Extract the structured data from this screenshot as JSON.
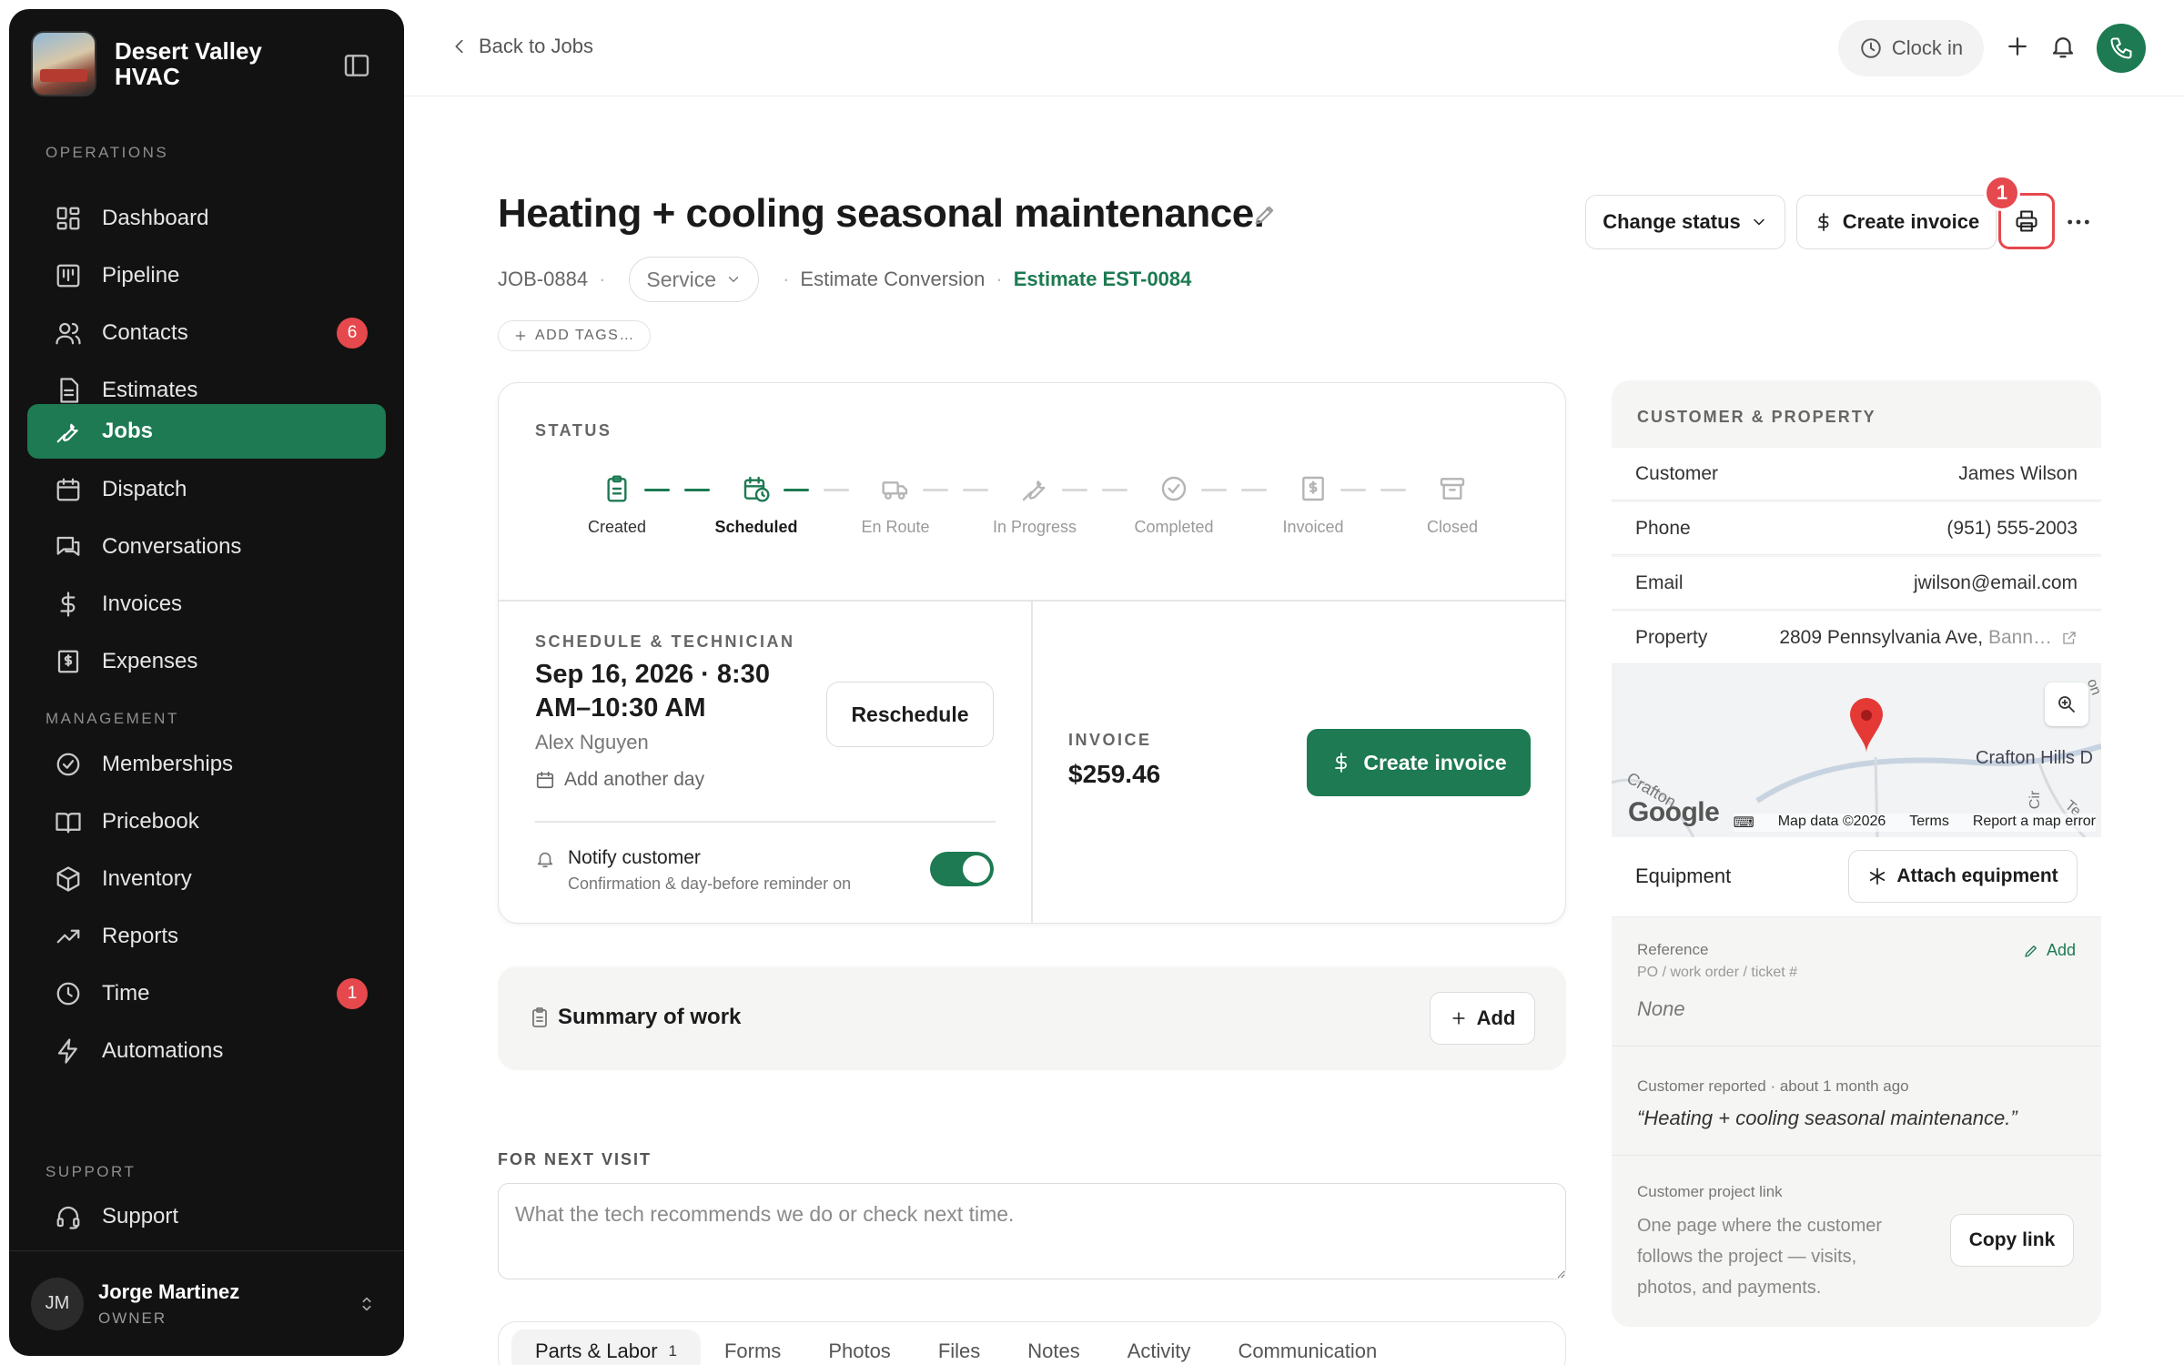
{
  "brand": {
    "name": "Desert Valley HVAC"
  },
  "sidebar": {
    "sections": {
      "operations": "OPERATIONS",
      "management": "MANAGEMENT",
      "support": "SUPPORT"
    },
    "items": [
      {
        "label": "Dashboard",
        "icon": "dashboard-icon"
      },
      {
        "label": "Pipeline",
        "icon": "pipeline-icon"
      },
      {
        "label": "Contacts",
        "icon": "contacts-icon",
        "badge": "6"
      },
      {
        "label": "Estimates",
        "icon": "estimates-icon"
      },
      {
        "label": "Jobs",
        "icon": "wrench-icon",
        "active": true
      },
      {
        "label": "Dispatch",
        "icon": "calendar-icon"
      },
      {
        "label": "Conversations",
        "icon": "chat-icon"
      },
      {
        "label": "Invoices",
        "icon": "dollar-icon"
      },
      {
        "label": "Expenses",
        "icon": "receipt-icon"
      },
      {
        "label": "Memberships",
        "icon": "badge-check-icon"
      },
      {
        "label": "Pricebook",
        "icon": "book-icon"
      },
      {
        "label": "Inventory",
        "icon": "box-icon"
      },
      {
        "label": "Reports",
        "icon": "trend-icon"
      },
      {
        "label": "Time",
        "icon": "clock-icon",
        "badge": "1"
      },
      {
        "label": "Automations",
        "icon": "bolt-icon"
      },
      {
        "label": "Support",
        "icon": "headset-icon"
      }
    ],
    "user": {
      "initials": "JM",
      "name": "Jorge Martinez",
      "role": "OWNER"
    }
  },
  "topbar": {
    "back_label": "Back to Jobs",
    "clock_label": "Clock in"
  },
  "job": {
    "title": "Heating + cooling seasonal maintenance.",
    "id": "JOB-0884",
    "type": "Service",
    "source": "Estimate Conversion",
    "estimate_link": "Estimate EST-0084",
    "add_tags": "ADD TAGS…",
    "actions": {
      "change_status": "Change status",
      "create_invoice": "Create invoice",
      "print_badge": "1"
    }
  },
  "status": {
    "label": "STATUS",
    "steps": [
      {
        "label": "Created",
        "state": "done"
      },
      {
        "label": "Scheduled",
        "state": "current"
      },
      {
        "label": "En Route",
        "state": "pending"
      },
      {
        "label": "In Progress",
        "state": "pending"
      },
      {
        "label": "Completed",
        "state": "pending"
      },
      {
        "label": "Invoiced",
        "state": "pending"
      },
      {
        "label": "Closed",
        "state": "pending"
      }
    ],
    "colors": {
      "accent": "#1d7a52",
      "pending": "#b5b5b5"
    }
  },
  "schedule": {
    "label": "SCHEDULE & TECHNICIAN",
    "date": "Sep 16, 2026 · 8:30 AM–10:30 AM",
    "technician": "Alex Nguyen",
    "add_day": "Add another day",
    "reschedule": "Reschedule",
    "notify_title": "Notify customer",
    "notify_sub": "Confirmation & day-before reminder on",
    "notify_on": true
  },
  "invoice": {
    "label": "INVOICE",
    "amount": "$259.46",
    "button": "Create invoice"
  },
  "summary": {
    "title": "Summary of work",
    "add": "Add"
  },
  "next_visit": {
    "label": "FOR NEXT VISIT",
    "placeholder": "What the tech recommends we do or check next time."
  },
  "tabs": [
    {
      "label": "Parts & Labor",
      "count": "1",
      "active": true
    },
    {
      "label": "Forms"
    },
    {
      "label": "Photos"
    },
    {
      "label": "Files"
    },
    {
      "label": "Notes"
    },
    {
      "label": "Activity"
    },
    {
      "label": "Communication"
    }
  ],
  "customer": {
    "section_label": "CUSTOMER & PROPERTY",
    "rows": {
      "customer_k": "Customer",
      "customer_v": "James Wilson",
      "phone_k": "Phone",
      "phone_v": "(951) 555-2003",
      "email_k": "Email",
      "email_v": "jwilson@email.com",
      "property_k": "Property",
      "property_v": "2809 Pennsylvania Ave,",
      "property_v_muted": "Bann…"
    },
    "map": {
      "street_main": "Crafton Hills D",
      "street_left": "Crafton",
      "street_vert": "Cir",
      "street_te": "Te",
      "street_top": "on H",
      "google": "Google",
      "footer": {
        "data": "Map data ©2026",
        "terms": "Terms",
        "report": "Report a map error"
      }
    },
    "equipment_k": "Equipment",
    "attach_btn": "Attach equipment",
    "reference": {
      "label": "Reference",
      "add": "Add",
      "sub": "PO / work order / ticket #",
      "value": "None"
    },
    "reported": {
      "label": "Customer reported · about 1 month ago",
      "quote": "“Heating + cooling seasonal maintenance.”"
    },
    "project_link": {
      "label": "Customer project link",
      "desc": "One page where the customer follows the project — visits, photos, and payments.",
      "button": "Copy link"
    }
  }
}
